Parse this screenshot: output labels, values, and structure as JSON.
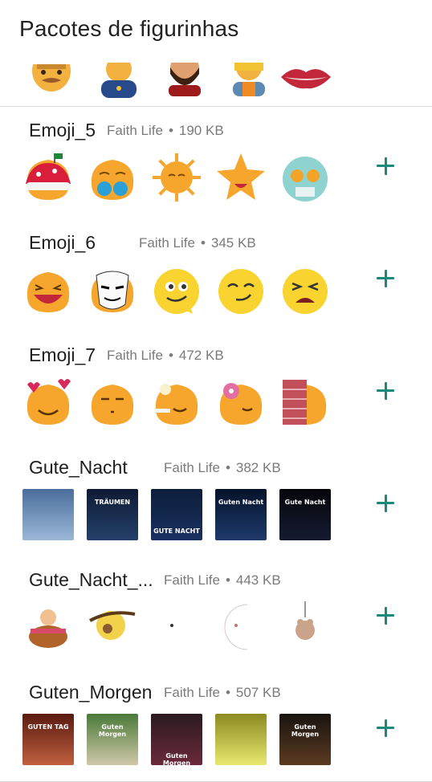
{
  "header": {
    "title": "Pacotes de figurinhas"
  },
  "top_row": {
    "icons": [
      "man-emoji-icon",
      "police-officer-emoji-icon",
      "bearded-man-emoji-icon",
      "woman-worker-emoji-icon",
      "lips-emoji-icon"
    ]
  },
  "packs": [
    {
      "name": "Emoji_5",
      "publisher": "Faith Life",
      "size": "190 KB",
      "stickers": [
        "emoji-santa-hat-sticker",
        "emoji-bikini-sticker",
        "emoji-sun-sticker",
        "emoji-star-sticker",
        "emoji-skull-sticker"
      ]
    },
    {
      "name": "Emoji_6",
      "publisher": "Faith Life",
      "size": "345 KB",
      "stickers": [
        "emoji-laughing-sticker",
        "emoji-mask-sticker",
        "emoji-speech-bubble-sticker",
        "emoji-smirk-sticker",
        "emoji-sad-sticker"
      ]
    },
    {
      "name": "Emoji_7",
      "publisher": "Faith Life",
      "size": "472 KB",
      "stickers": [
        "emoji-hearts-sticker",
        "emoji-neutral-sticker",
        "emoji-lightbulb-sticker",
        "emoji-donut-sticker",
        "emoji-brick-wall-sticker"
      ]
    },
    {
      "name": "Gute_Nacht",
      "publisher": "Faith Life",
      "size": "382 KB",
      "stickers": [
        "teddy-bear-night-sticker",
        "traumen-card-sticker",
        "gute-nacht-card-sticker",
        "gute-nacht-owl-sticker",
        "moon-gute-nacht-sticker"
      ],
      "captions": [
        "",
        "TRÄUMEN",
        "GUTE NACHT",
        "Guten Nacht",
        "Gute Nacht"
      ]
    },
    {
      "name": "Gute_Nacht_...",
      "publisher": "Faith Life",
      "size": "443 KB",
      "stickers": [
        "baby-basket-sticker",
        "tree-moon-sticker",
        "crescent-moon-sticker",
        "moon-face-sticker",
        "hanging-bear-sticker"
      ]
    },
    {
      "name": "Guten_Morgen",
      "publisher": "Faith Life",
      "size": "507 KB",
      "stickers": [
        "guten-tag-card-sticker",
        "guten-morgen-flowers-sticker",
        "guten-morgen-card-sticker",
        "guten-morgen-text-sticker",
        "guten-morgen-cup-sticker"
      ],
      "captions": [
        "GUTEN TAG",
        "Guten Morgen",
        "Guten Morgen",
        "",
        "Guten Morgen"
      ]
    }
  ],
  "colors": {
    "accent": "#19897a",
    "divider": "#dcdcdc",
    "meta_text": "#7a7a7a",
    "emoji_orange": "#f6a62c",
    "emoji_yellow": "#f9d330"
  }
}
